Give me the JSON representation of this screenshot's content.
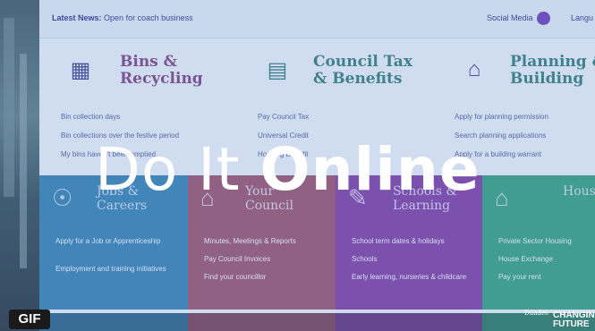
{
  "topbar": {
    "news_label": "Latest News:",
    "news_text": "Open for coach business",
    "social_label": "Social Media",
    "language_label": "Langu"
  },
  "services": [
    {
      "title_line1": "Bins &",
      "title_line2": "Recycling",
      "links": [
        "Bin collection days",
        "Bin collections over the festive period",
        "My bins haven't been emptied"
      ]
    },
    {
      "title_line1": "Council Tax",
      "title_line2": "& Benefits",
      "links": [
        "Pay Council Tax",
        "Universal Credit",
        "Housing Benefit"
      ]
    },
    {
      "title_line1": "Planning &",
      "title_line2": "Building",
      "links": [
        "Apply for planning permission",
        "Search planning applications",
        "Apply for a building warrant"
      ]
    }
  ],
  "tiles": [
    {
      "title_line1": "Jobs &",
      "title_line2": "Careers",
      "color": "#2f7fb0",
      "links": [
        "Apply for a Job or Apprenticeship",
        "Employment and training initiatives"
      ]
    },
    {
      "title_line1": "Your",
      "title_line2": "Council",
      "color": "#9a4f6a",
      "links": [
        "Minutes, Meetings & Reports",
        "Pay Council Invoices",
        "Find your councillor"
      ]
    },
    {
      "title_line1": "Schools &",
      "title_line2": "Learning",
      "color": "#7e3aa0",
      "links": [
        "School term dates & holidays",
        "Schools",
        "Early learning, nurseries & childcare"
      ]
    },
    {
      "title_line1": "Housing",
      "title_line2": "",
      "color": "#2f9f7a",
      "links": [
        "Private Sector Housing",
        "House Exchange",
        "Pay your rent"
      ]
    }
  ],
  "headline": {
    "part1": "Do It ",
    "part2": "Online"
  },
  "badge": {
    "label": "GIF"
  },
  "logo": {
    "small": "Dundee",
    "big_line1": "CHANGING",
    "big_line2": "FUTURE"
  },
  "colors": {
    "overlay": "rgba(120,150,210,.25)",
    "accent_purple": "#6a3bb8",
    "title_purple": "#7a3f7e",
    "title_teal": "#2e7a74"
  }
}
